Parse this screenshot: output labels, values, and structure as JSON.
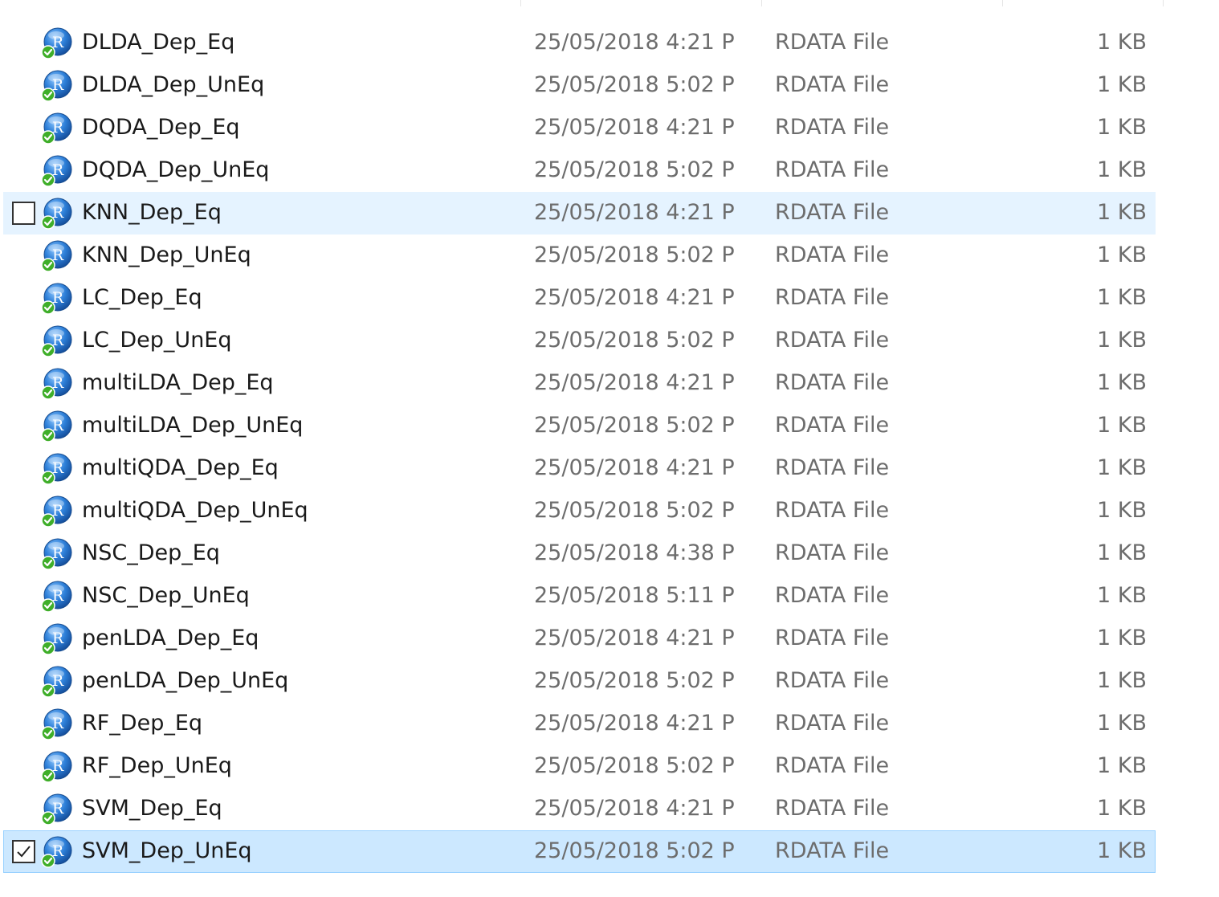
{
  "files": [
    {
      "name": "DLDA_Dep_Eq",
      "date": "25/05/2018 4:21 P",
      "type": "RDATA File",
      "size": "1 KB",
      "state": "normal",
      "icon": "r-data-file-icon"
    },
    {
      "name": "DLDA_Dep_UnEq",
      "date": "25/05/2018 5:02 P",
      "type": "RDATA File",
      "size": "1 KB",
      "state": "normal",
      "icon": "r-data-file-icon"
    },
    {
      "name": "DQDA_Dep_Eq",
      "date": "25/05/2018 4:21 P",
      "type": "RDATA File",
      "size": "1 KB",
      "state": "normal",
      "icon": "r-data-file-icon"
    },
    {
      "name": "DQDA_Dep_UnEq",
      "date": "25/05/2018 5:02 P",
      "type": "RDATA File",
      "size": "1 KB",
      "state": "normal",
      "icon": "r-data-file-icon"
    },
    {
      "name": "KNN_Dep_Eq",
      "date": "25/05/2018 4:21 P",
      "type": "RDATA File",
      "size": "1 KB",
      "state": "hover",
      "icon": "r-data-file-icon"
    },
    {
      "name": "KNN_Dep_UnEq",
      "date": "25/05/2018 5:02 P",
      "type": "RDATA File",
      "size": "1 KB",
      "state": "normal",
      "icon": "r-data-file-icon"
    },
    {
      "name": "LC_Dep_Eq",
      "date": "25/05/2018 4:21 P",
      "type": "RDATA File",
      "size": "1 KB",
      "state": "normal",
      "icon": "r-data-file-icon"
    },
    {
      "name": "LC_Dep_UnEq",
      "date": "25/05/2018 5:02 P",
      "type": "RDATA File",
      "size": "1 KB",
      "state": "normal",
      "icon": "r-data-file-icon"
    },
    {
      "name": "multiLDA_Dep_Eq",
      "date": "25/05/2018 4:21 P",
      "type": "RDATA File",
      "size": "1 KB",
      "state": "normal",
      "icon": "r-data-file-icon"
    },
    {
      "name": "multiLDA_Dep_UnEq",
      "date": "25/05/2018 5:02 P",
      "type": "RDATA File",
      "size": "1 KB",
      "state": "normal",
      "icon": "r-data-file-icon"
    },
    {
      "name": "multiQDA_Dep_Eq",
      "date": "25/05/2018 4:21 P",
      "type": "RDATA File",
      "size": "1 KB",
      "state": "normal",
      "icon": "r-data-file-icon"
    },
    {
      "name": "multiQDA_Dep_UnEq",
      "date": "25/05/2018 5:02 P",
      "type": "RDATA File",
      "size": "1 KB",
      "state": "normal",
      "icon": "r-data-file-icon"
    },
    {
      "name": "NSC_Dep_Eq",
      "date": "25/05/2018 4:38 P",
      "type": "RDATA File",
      "size": "1 KB",
      "state": "normal",
      "icon": "r-data-file-icon"
    },
    {
      "name": "NSC_Dep_UnEq",
      "date": "25/05/2018 5:11 P",
      "type": "RDATA File",
      "size": "1 KB",
      "state": "normal",
      "icon": "r-data-file-icon"
    },
    {
      "name": "penLDA_Dep_Eq",
      "date": "25/05/2018 4:21 P",
      "type": "RDATA File",
      "size": "1 KB",
      "state": "normal",
      "icon": "r-data-file-icon"
    },
    {
      "name": "penLDA_Dep_UnEq",
      "date": "25/05/2018 5:02 P",
      "type": "RDATA File",
      "size": "1 KB",
      "state": "normal",
      "icon": "r-data-file-icon"
    },
    {
      "name": "RF_Dep_Eq",
      "date": "25/05/2018 4:21 P",
      "type": "RDATA File",
      "size": "1 KB",
      "state": "normal",
      "icon": "r-data-file-icon"
    },
    {
      "name": "RF_Dep_UnEq",
      "date": "25/05/2018 5:02 P",
      "type": "RDATA File",
      "size": "1 KB",
      "state": "normal",
      "icon": "r-data-file-icon"
    },
    {
      "name": "SVM_Dep_Eq",
      "date": "25/05/2018 4:21 P",
      "type": "RDATA File",
      "size": "1 KB",
      "state": "normal",
      "icon": "r-data-file-icon"
    },
    {
      "name": "SVM_Dep_UnEq",
      "date": "25/05/2018 5:02 P",
      "type": "RDATA File",
      "size": "1 KB",
      "state": "selected",
      "icon": "r-data-file-icon"
    }
  ],
  "icon_badge": "R",
  "colors": {
    "hover_row": "#e5f3ff",
    "selected_row": "#cce8ff",
    "selected_border": "#99d1ff",
    "secondary_text": "#6d6d6d",
    "sync_check": "#3fae29"
  }
}
